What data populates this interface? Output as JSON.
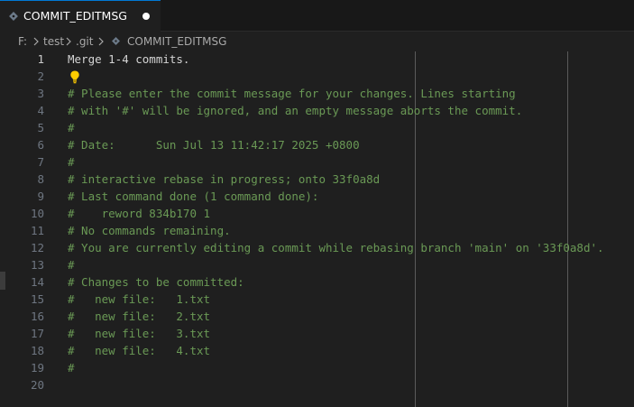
{
  "tab": {
    "title": "COMMIT_EDITMSG",
    "icon": "git-file-icon",
    "modified": true
  },
  "breadcrumb": {
    "items": [
      "F:",
      "test",
      ".git",
      "COMMIT_EDITMSG"
    ]
  },
  "editor": {
    "lines": [
      {
        "n": "1",
        "text": "Merge 1-4 commits."
      },
      {
        "n": "2",
        "text": ""
      },
      {
        "n": "3",
        "text": "# Please enter the commit message for your changes. Lines starting"
      },
      {
        "n": "4",
        "text": "# with '#' will be ignored, and an empty message aborts the commit."
      },
      {
        "n": "5",
        "text": "#"
      },
      {
        "n": "6",
        "text": "# Date:      Sun Jul 13 11:42:17 2025 +0800"
      },
      {
        "n": "7",
        "text": "#"
      },
      {
        "n": "8",
        "text": "# interactive rebase in progress; onto 33f0a8d"
      },
      {
        "n": "9",
        "text": "# Last command done (1 command done):"
      },
      {
        "n": "10",
        "text": "#    reword 834b170 1"
      },
      {
        "n": "11",
        "text": "# No commands remaining."
      },
      {
        "n": "12",
        "text": "# You are currently editing a commit while rebasing branch 'main' on '33f0a8d'."
      },
      {
        "n": "13",
        "text": "#"
      },
      {
        "n": "14",
        "text": "# Changes to be committed:"
      },
      {
        "n": "15",
        "text": "#   new file:   1.txt"
      },
      {
        "n": "16",
        "text": "#   new file:   2.txt"
      },
      {
        "n": "17",
        "text": "#   new file:   3.txt"
      },
      {
        "n": "18",
        "text": "#   new file:   4.txt"
      },
      {
        "n": "19",
        "text": "#"
      },
      {
        "n": "20",
        "text": ""
      }
    ]
  },
  "colors": {
    "comment": "#6a9955",
    "plain": "#d4d4d4",
    "accent": "#0078d4",
    "lightbulb": "#ffcc00"
  }
}
